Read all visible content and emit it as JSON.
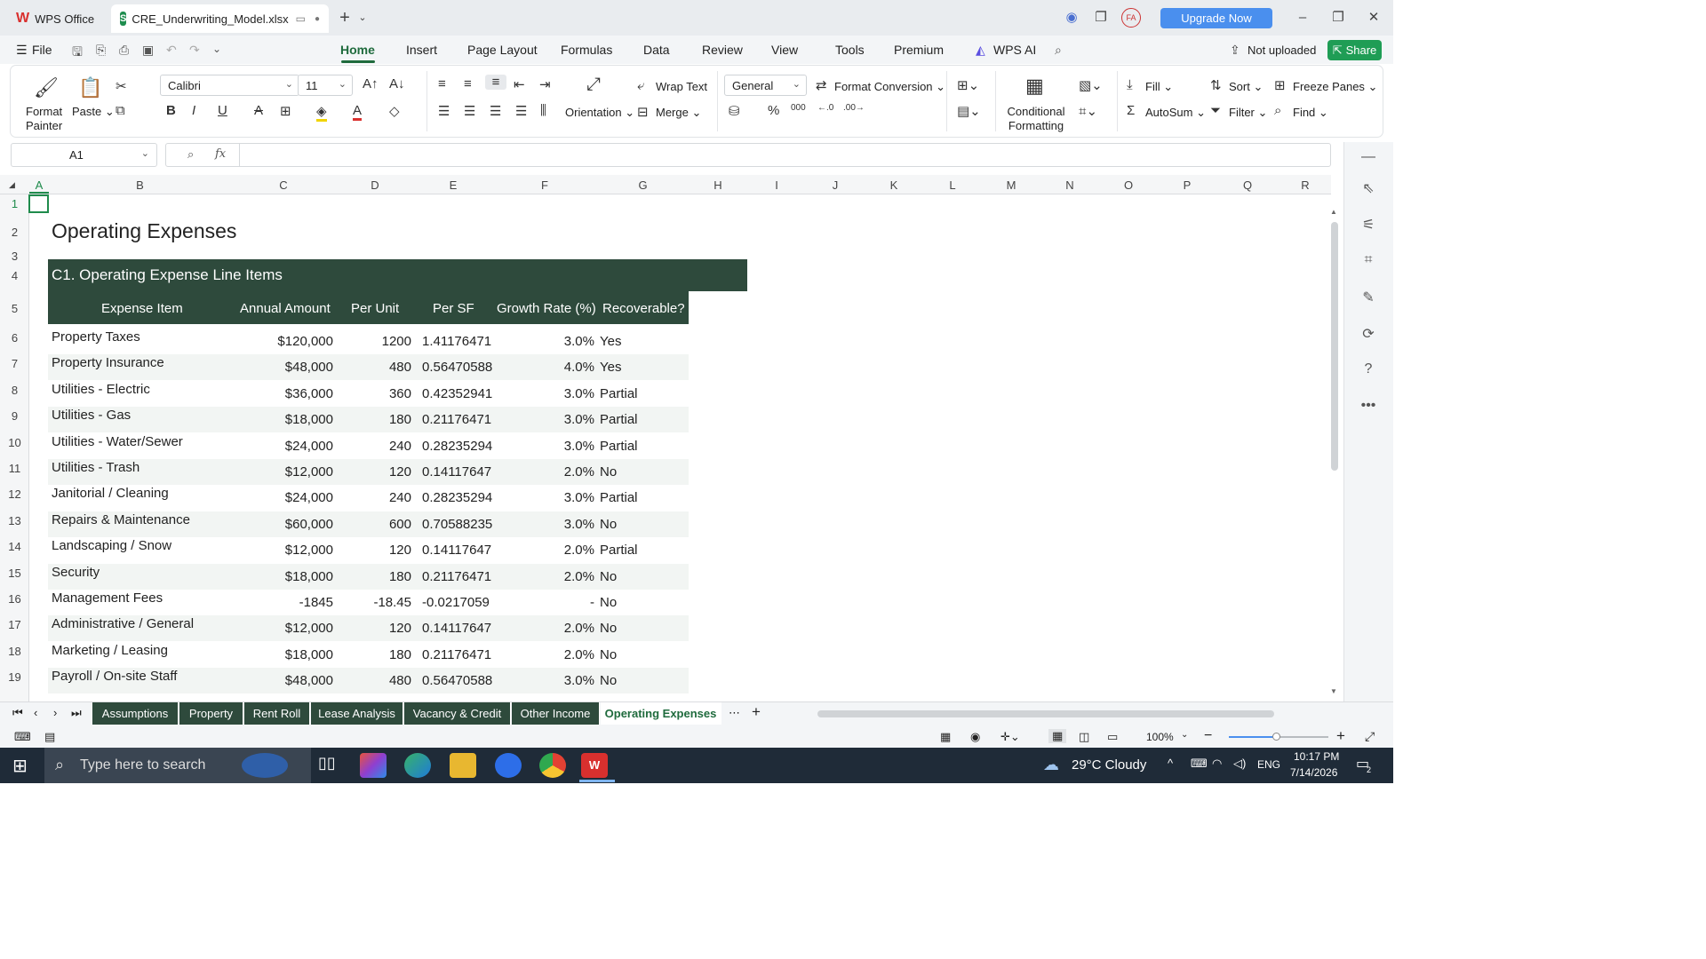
{
  "titlebar": {
    "app_tab": "WPS Office",
    "file_tab": "CRE_Underwriting_Model.xlsx",
    "upgrade": "Upgrade Now",
    "avatar": "FA"
  },
  "menu": {
    "file": "File",
    "items": [
      "Home",
      "Insert",
      "Page Layout",
      "Formulas",
      "Data",
      "Review",
      "View",
      "Tools",
      "Premium",
      "WPS AI"
    ],
    "not_uploaded": "Not uploaded",
    "share": "Share"
  },
  "ribbon": {
    "format_painter": "Format Painter",
    "paste": "Paste",
    "font_name": "Calibri",
    "font_size": "11",
    "wrap_text": "Wrap Text",
    "merge": "Merge",
    "orientation": "Orientation",
    "number_format": "General",
    "format_conversion": "Format Conversion",
    "conditional_formatting": "Conditional Formatting",
    "fill": "Fill",
    "autosum": "AutoSum",
    "sort": "Sort",
    "filter": "Filter",
    "freeze_panes": "Freeze Panes",
    "find": "Find"
  },
  "formula_bar": {
    "cell_ref": "A1",
    "fx": "fx",
    "content": ""
  },
  "columns": [
    "A",
    "B",
    "C",
    "D",
    "E",
    "F",
    "G",
    "H",
    "I",
    "J",
    "K",
    "L",
    "M",
    "N",
    "O",
    "P",
    "Q",
    "R"
  ],
  "rows": [
    "1",
    "2",
    "3",
    "4",
    "5",
    "6",
    "7",
    "8",
    "9",
    "10",
    "11",
    "12",
    "13",
    "14",
    "15",
    "16",
    "17",
    "18",
    "19"
  ],
  "sheet": {
    "title": "Operating Expenses",
    "section": "C1. Operating Expense Line Items",
    "headers": [
      "Expense Item",
      "Annual Amount",
      "Per Unit",
      "Per SF",
      "Growth Rate (%)",
      "Recoverable?"
    ],
    "data": [
      [
        "Property Taxes",
        "$120,000",
        "1200",
        "1.41176471",
        "3.0%",
        "Yes"
      ],
      [
        "Property Insurance",
        "$48,000",
        "480",
        "0.56470588",
        "4.0%",
        "Yes"
      ],
      [
        "Utilities - Electric",
        "$36,000",
        "360",
        "0.42352941",
        "3.0%",
        "Partial"
      ],
      [
        "Utilities - Gas",
        "$18,000",
        "180",
        "0.21176471",
        "3.0%",
        "Partial"
      ],
      [
        "Utilities - Water/Sewer",
        "$24,000",
        "240",
        "0.28235294",
        "3.0%",
        "Partial"
      ],
      [
        "Utilities - Trash",
        "$12,000",
        "120",
        "0.14117647",
        "2.0%",
        "No"
      ],
      [
        "Janitorial / Cleaning",
        "$24,000",
        "240",
        "0.28235294",
        "3.0%",
        "Partial"
      ],
      [
        "Repairs & Maintenance",
        "$60,000",
        "600",
        "0.70588235",
        "3.0%",
        "No"
      ],
      [
        "Landscaping / Snow",
        "$12,000",
        "120",
        "0.14117647",
        "2.0%",
        "Partial"
      ],
      [
        "Security",
        "$18,000",
        "180",
        "0.21176471",
        "2.0%",
        "No"
      ],
      [
        "Management Fees",
        "-1845",
        "-18.45",
        "-0.0217059",
        "-",
        "No"
      ],
      [
        "Administrative / General",
        "$12,000",
        "120",
        "0.14117647",
        "2.0%",
        "No"
      ],
      [
        "Marketing / Leasing",
        "$18,000",
        "180",
        "0.21176471",
        "2.0%",
        "No"
      ],
      [
        "Payroll / On-site Staff",
        "$48,000",
        "480",
        "0.56470588",
        "3.0%",
        "No"
      ]
    ]
  },
  "sheet_tabs": [
    "Assumptions",
    "Property",
    "Rent Roll",
    "Lease Analysis",
    "Vacancy & Credit",
    "Other Income",
    "Operating Expenses"
  ],
  "active_sheet": "Operating Expenses",
  "status": {
    "zoom": "100%"
  },
  "taskbar": {
    "search_placeholder": "Type here to search",
    "weather": "29°C  Cloudy",
    "lang": "ENG",
    "time": "10:17 PM",
    "date": "7/14/2026",
    "notifications": "2"
  }
}
